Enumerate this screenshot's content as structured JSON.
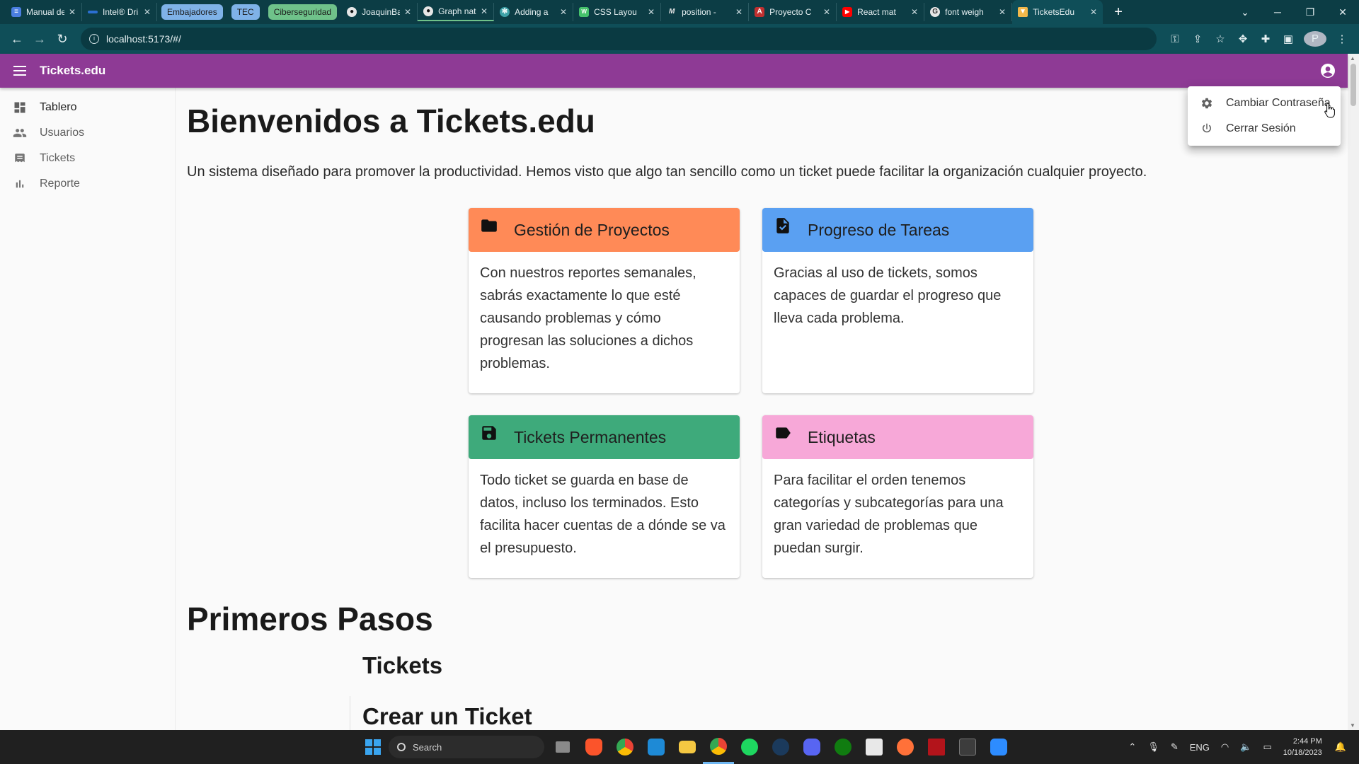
{
  "browser": {
    "tabs": [
      {
        "title": "Manual de",
        "favicon_color": "#4a7ee0"
      },
      {
        "title": "Intel® Dri",
        "favicon_color": "#2b6fd1"
      },
      {
        "title": "JoaquinBa",
        "favicon_color": "#e6e6e6"
      },
      {
        "title": "Graph nat",
        "favicon_color": "#e6e6e6"
      },
      {
        "title": "Adding a ",
        "favicon_color": "#3fa2a8"
      },
      {
        "title": "CSS Layou",
        "favicon_color": "#46c26c"
      },
      {
        "title": "position - ",
        "favicon_color": "#e6e6e6"
      },
      {
        "title": "Proyecto C",
        "favicon_color": "#c03030"
      },
      {
        "title": "React mat",
        "favicon_color": "#ff0000"
      },
      {
        "title": "font weigh",
        "favicon_color": "#e6e6e6"
      },
      {
        "title": "TicketsEdu",
        "favicon_color": "#f2b84b"
      }
    ],
    "tab_groups": [
      {
        "label": "Embajadores",
        "color": "#7fb2e8"
      },
      {
        "label": "TEC",
        "color": "#7fb2e8"
      },
      {
        "label": "Ciberseguridad",
        "color": "#6fc28a"
      }
    ],
    "address": "localhost:5173/#/"
  },
  "app": {
    "title": "Tickets.edu",
    "brand_color": "#8e3a95"
  },
  "sidebar": {
    "items": [
      {
        "label": "Tablero",
        "icon": "dashboard-icon"
      },
      {
        "label": "Usuarios",
        "icon": "people-icon"
      },
      {
        "label": "Tickets",
        "icon": "receipt-icon"
      },
      {
        "label": "Reporte",
        "icon": "bar-chart-icon"
      }
    ]
  },
  "main": {
    "heading": "Bienvenidos a Tickets.edu",
    "intro": "Un sistema diseñado para promover la productividad. Hemos visto que algo tan sencillo como un ticket puede facilitar la organización cualquier proyecto.",
    "cards": [
      {
        "title": "Gestión de Proyectos",
        "icon": "folder-icon",
        "color": "#ff8a57",
        "body": "Con nuestros reportes semanales, sabrás exactamente lo que esté causando problemas y cómo progresan las soluciones a dichos problemas."
      },
      {
        "title": "Progreso de Tareas",
        "icon": "task-file-icon",
        "color": "#5aa0f2",
        "body": "Gracias al uso de tickets, somos capaces de guardar el progreso que lleva cada problema."
      },
      {
        "title": "Tickets Permanentes",
        "icon": "save-icon",
        "color": "#3eaa7b",
        "body": "Todo ticket se guarda en base de datos, incluso los terminados. Esto facilita hacer cuentas de a dónde se va el presupuesto."
      },
      {
        "title": "Etiquetas",
        "icon": "label-icon",
        "color": "#f7a8d8",
        "body": "Para facilitar el orden tenemos categorías y subcategorías para una gran variedad de problemas que puedan surgir."
      }
    ],
    "section_title": "Primeros Pasos",
    "subsection_title": "Tickets",
    "subsubsection_title": "Crear un Ticket"
  },
  "account_menu": {
    "items": [
      {
        "label": "Cambiar Contraseña",
        "icon": "gear-icon"
      },
      {
        "label": "Cerrar Sesión",
        "icon": "power-icon"
      }
    ]
  },
  "taskbar": {
    "search_placeholder": "Search",
    "language": "ENG",
    "time": "2:44 PM",
    "date": "10/18/2023"
  }
}
